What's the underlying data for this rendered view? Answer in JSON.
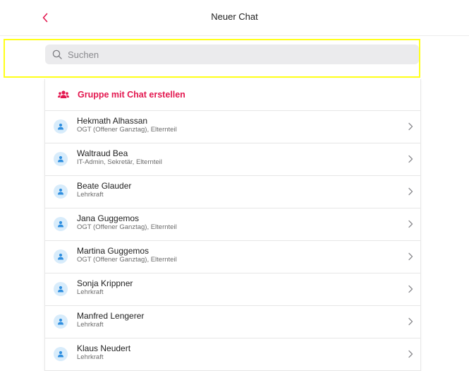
{
  "header": {
    "title": "Neuer Chat",
    "back_icon": "chevron-left-icon"
  },
  "search": {
    "placeholder": "Suchen",
    "value": ""
  },
  "group_action": {
    "label": "Gruppe mit Chat erstellen",
    "icon": "group-icon"
  },
  "contacts": [
    {
      "name": "Hekmath Alhassan",
      "roles": "OGT (Offener Ganztag), Elternteil"
    },
    {
      "name": "Waltraud Bea",
      "roles": "IT-Admin, Sekretär, Elternteil"
    },
    {
      "name": "Beate Glauder",
      "roles": "Lehrkraft"
    },
    {
      "name": "Jana Guggemos",
      "roles": "OGT (Offener Ganztag), Elternteil"
    },
    {
      "name": "Martina Guggemos",
      "roles": "OGT (Offener Ganztag), Elternteil"
    },
    {
      "name": "Sonja Krippner",
      "roles": "Lehrkraft"
    },
    {
      "name": "Manfred Lengerer",
      "roles": "Lehrkraft"
    },
    {
      "name": "Klaus Neudert",
      "roles": "Lehrkraft"
    }
  ],
  "colors": {
    "accent": "#e3174f",
    "avatar_bg": "#d8ecfb",
    "avatar_icon": "#2f8fe0",
    "highlight": "#ffff1a"
  }
}
